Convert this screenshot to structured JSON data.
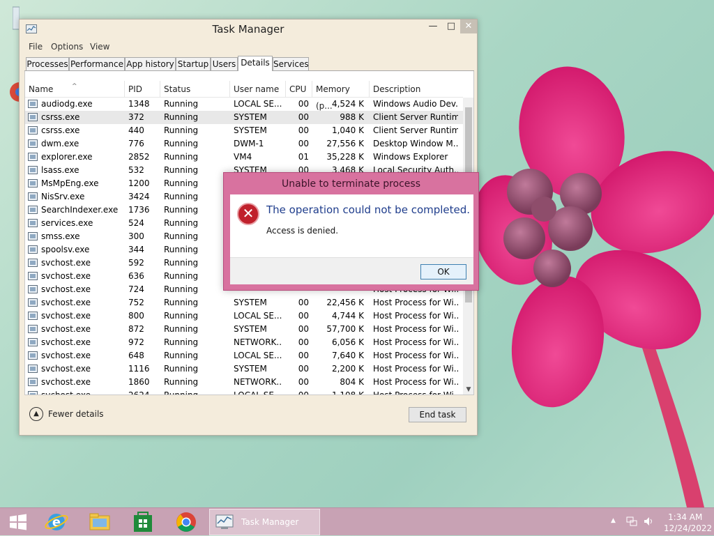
{
  "window": {
    "title": "Task Manager",
    "minimize": "—",
    "maximize": "□",
    "close": "✕"
  },
  "menu": [
    "File",
    "Options",
    "View"
  ],
  "tabs": [
    {
      "label": "Processes"
    },
    {
      "label": "Performance"
    },
    {
      "label": "App history"
    },
    {
      "label": "Startup"
    },
    {
      "label": "Users"
    },
    {
      "label": "Details",
      "active": true
    },
    {
      "label": "Services"
    }
  ],
  "columns": [
    "Name",
    "PID",
    "Status",
    "User name",
    "CPU",
    "Memory (p...",
    "Description"
  ],
  "rows": [
    {
      "name": "audiodg.exe",
      "pid": "1348",
      "status": "Running",
      "user": "LOCAL SE...",
      "cpu": "00",
      "mem": "4,524 K",
      "desc": "Windows Audio Dev..."
    },
    {
      "name": "csrss.exe",
      "pid": "372",
      "status": "Running",
      "user": "SYSTEM",
      "cpu": "00",
      "mem": "988 K",
      "desc": "Client Server Runtim..."
    },
    {
      "name": "csrss.exe",
      "pid": "440",
      "status": "Running",
      "user": "SYSTEM",
      "cpu": "00",
      "mem": "1,040 K",
      "desc": "Client Server Runtim..."
    },
    {
      "name": "dwm.exe",
      "pid": "776",
      "status": "Running",
      "user": "DWM-1",
      "cpu": "00",
      "mem": "27,556 K",
      "desc": "Desktop Window M..."
    },
    {
      "name": "explorer.exe",
      "pid": "2852",
      "status": "Running",
      "user": "VM4",
      "cpu": "01",
      "mem": "35,228 K",
      "desc": "Windows Explorer"
    },
    {
      "name": "lsass.exe",
      "pid": "532",
      "status": "Running",
      "user": "SYSTEM",
      "cpu": "00",
      "mem": "3,468 K",
      "desc": "Local Security Auth..."
    },
    {
      "name": "MsMpEng.exe",
      "pid": "1200",
      "status": "Running",
      "user": "",
      "cpu": "",
      "mem": "",
      "desc": ""
    },
    {
      "name": "NisSrv.exe",
      "pid": "3424",
      "status": "Running",
      "user": "",
      "cpu": "",
      "mem": "",
      "desc": ""
    },
    {
      "name": "SearchIndexer.exe",
      "pid": "1736",
      "status": "Running",
      "user": "",
      "cpu": "",
      "mem": "",
      "desc": ""
    },
    {
      "name": "services.exe",
      "pid": "524",
      "status": "Running",
      "user": "",
      "cpu": "",
      "mem": "",
      "desc": ""
    },
    {
      "name": "smss.exe",
      "pid": "300",
      "status": "Running",
      "user": "",
      "cpu": "",
      "mem": "",
      "desc": ""
    },
    {
      "name": "spoolsv.exe",
      "pid": "344",
      "status": "Running",
      "user": "",
      "cpu": "",
      "mem": "",
      "desc": ""
    },
    {
      "name": "svchost.exe",
      "pid": "592",
      "status": "Running",
      "user": "",
      "cpu": "",
      "mem": "",
      "desc": ""
    },
    {
      "name": "svchost.exe",
      "pid": "636",
      "status": "Running",
      "user": "",
      "cpu": "",
      "mem": "",
      "desc": ""
    },
    {
      "name": "svchost.exe",
      "pid": "724",
      "status": "Running",
      "user": "",
      "cpu": "",
      "mem": "",
      "desc": "Host Process for Wi..."
    },
    {
      "name": "svchost.exe",
      "pid": "752",
      "status": "Running",
      "user": "SYSTEM",
      "cpu": "00",
      "mem": "22,456 K",
      "desc": "Host Process for Wi..."
    },
    {
      "name": "svchost.exe",
      "pid": "800",
      "status": "Running",
      "user": "LOCAL SE...",
      "cpu": "00",
      "mem": "4,744 K",
      "desc": "Host Process for Wi..."
    },
    {
      "name": "svchost.exe",
      "pid": "872",
      "status": "Running",
      "user": "SYSTEM",
      "cpu": "00",
      "mem": "57,700 K",
      "desc": "Host Process for Wi..."
    },
    {
      "name": "svchost.exe",
      "pid": "972",
      "status": "Running",
      "user": "NETWORK...",
      "cpu": "00",
      "mem": "6,056 K",
      "desc": "Host Process for Wi..."
    },
    {
      "name": "svchost.exe",
      "pid": "648",
      "status": "Running",
      "user": "LOCAL SE...",
      "cpu": "00",
      "mem": "7,640 K",
      "desc": "Host Process for Wi..."
    },
    {
      "name": "svchost.exe",
      "pid": "1116",
      "status": "Running",
      "user": "SYSTEM",
      "cpu": "00",
      "mem": "2,200 K",
      "desc": "Host Process for Wi..."
    },
    {
      "name": "svchost.exe",
      "pid": "1860",
      "status": "Running",
      "user": "NETWORK...",
      "cpu": "00",
      "mem": "804 K",
      "desc": "Host Process for Wi..."
    },
    {
      "name": "svchost.exe",
      "pid": "2624",
      "status": "Running",
      "user": "LOCAL SE...",
      "cpu": "00",
      "mem": "1,108 K",
      "desc": "Host Process for Wi..."
    }
  ],
  "selected_row": 1,
  "footer": {
    "fewer_details": "Fewer details",
    "end_task": "End task"
  },
  "dialog": {
    "title": "Unable to terminate process",
    "heading": "The operation could not be completed.",
    "message": "Access is denied.",
    "ok": "OK"
  },
  "taskbar": {
    "active_app": "Task Manager",
    "time": "1:34 AM",
    "date": "12/24/2022"
  },
  "colors": {
    "dialog_accent": "#d8729f",
    "taskbar": "#c8a2b4",
    "heading_blue": "#1f3d8c"
  }
}
